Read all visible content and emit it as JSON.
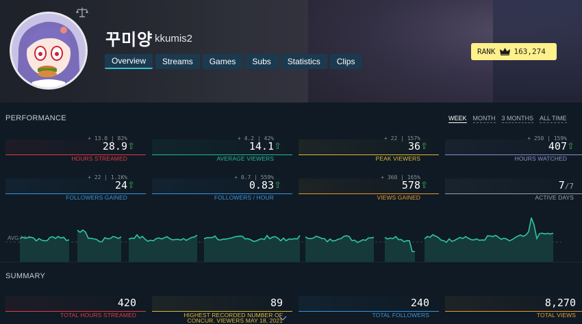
{
  "channel": {
    "display_name": "꾸미양",
    "login": "kkumis2"
  },
  "tabs": [
    {
      "label": "Overview",
      "active": true
    },
    {
      "label": "Streams",
      "active": false
    },
    {
      "label": "Games",
      "active": false
    },
    {
      "label": "Subs",
      "active": false
    },
    {
      "label": "Statistics",
      "active": false
    },
    {
      "label": "Clips",
      "active": false
    }
  ],
  "rank": {
    "label": "RANK",
    "value": "163,274",
    "icon": "crown-icon",
    "color": "#fef08a"
  },
  "performance": {
    "title": "PERFORMANCE",
    "periods": [
      "WEEK",
      "MONTH",
      "3 MONTHS",
      "ALL TIME"
    ],
    "active_period": "WEEK",
    "avg_label": "AVG 14.1",
    "stats": [
      {
        "delta": "+ 13.0 | 82%",
        "value": "28.9",
        "label": "HOURS STREAMED",
        "color": "#e23b44",
        "trend": "up"
      },
      {
        "delta": "+ 4.2 | 42%",
        "value": "14.1",
        "label": "AVERAGE VIEWERS",
        "color": "#29b89a",
        "trend": "up"
      },
      {
        "delta": "+ 22 | 157%",
        "value": "36",
        "label": "PEAK VIEWERS",
        "color": "#e0b83c",
        "trend": "up"
      },
      {
        "delta": "+ 250 | 159%",
        "value": "407",
        "label": "HOURS WATCHED",
        "color": "#8a92c9",
        "trend": "up"
      },
      {
        "delta": "+ 22 | 1.1K%",
        "value": "24",
        "label": "FOLLOWERS GAINED",
        "color": "#3d95dc",
        "trend": "up"
      },
      {
        "delta": "+ 0.7 | 559%",
        "value": "0.83",
        "label": "FOLLOWERS / HOUR",
        "color": "#3d95dc",
        "trend": "up"
      },
      {
        "delta": "+ 360 | 165%",
        "value": "578",
        "label": "VIEWS GAINED",
        "color": "#e89a34",
        "trend": "up"
      },
      {
        "delta": "",
        "value": "7",
        "value_suffix": "/7",
        "label": "ACTIVE DAYS",
        "color": "#9aa3ab",
        "trend": "none"
      }
    ]
  },
  "summary": {
    "title": "SUMMARY",
    "stats": [
      {
        "value": "420",
        "label": "TOTAL HOURS STREAMED",
        "color": "#e23b44"
      },
      {
        "value": "89",
        "label": "HIGHEST RECORDED NUMBER OF",
        "label2": "CONCUR. VIEWERS MAY 18, 2021",
        "color": "#e0b83c"
      },
      {
        "value": "240",
        "label": "TOTAL FOLLOWERS",
        "color": "#3d95dc"
      },
      {
        "value": "8,270",
        "label": "TOTAL VIEWS",
        "color": "#e89a34"
      }
    ]
  }
}
